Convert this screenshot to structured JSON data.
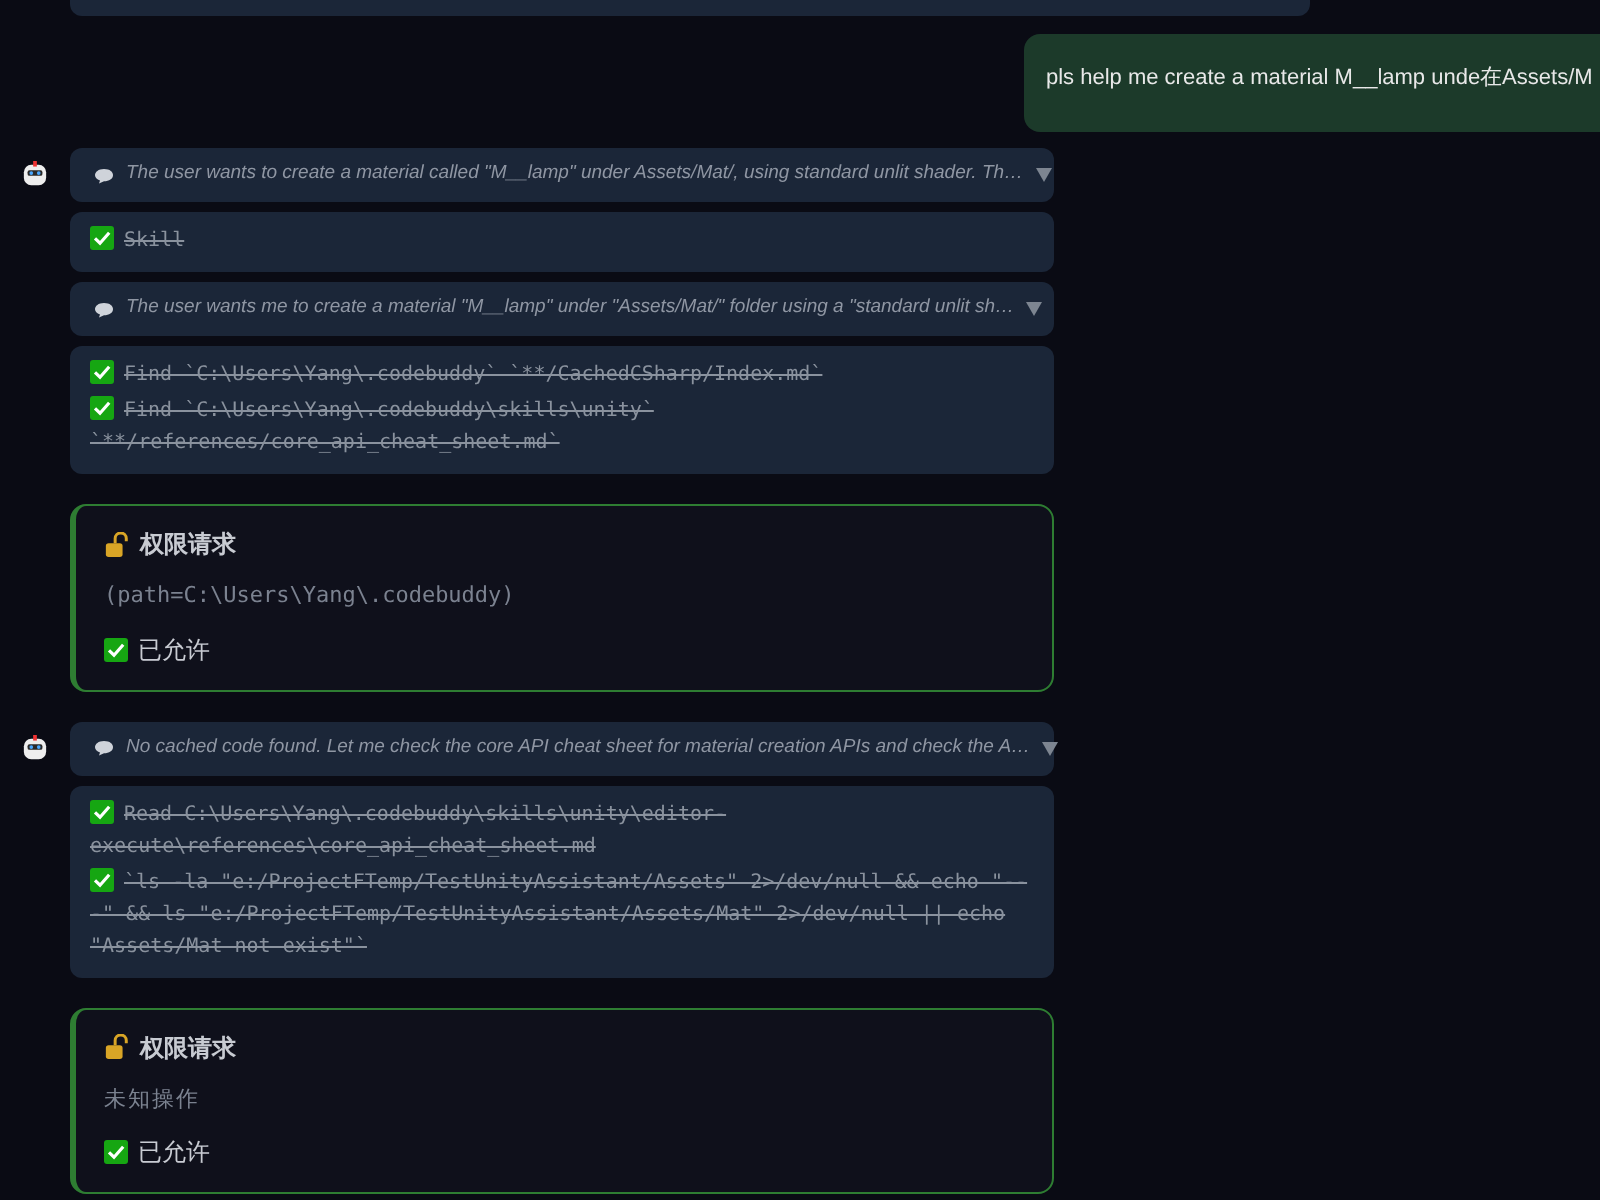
{
  "user_message": {
    "text": "pls help me create a material M__lamp unde在Assets/M"
  },
  "assistant_turns": [
    {
      "blocks": [
        {
          "kind": "thought",
          "text": "The user wants to create a material called \"M__lamp\" under Assets/Mat/, using standard unlit shader. Th…",
          "expanded": false
        },
        {
          "kind": "tools",
          "items": [
            {
              "text": "Skill",
              "done": true
            }
          ]
        },
        {
          "kind": "thought",
          "text": "The user wants me to create a material \"M__lamp\" under \"Assets/Mat/\" folder using a \"standard unlit sh…",
          "expanded": false
        },
        {
          "kind": "tools",
          "items": [
            {
              "text": "Find `C:\\Users\\Yang\\.codebuddy` `**/CachedCSharp/Index.md`",
              "done": true
            },
            {
              "text": "Find `C:\\Users\\Yang\\.codebuddy\\skills\\unity` `**/references/core_api_cheat_sheet.md`",
              "done": true
            }
          ]
        },
        {
          "kind": "permission",
          "title": "权限请求",
          "detail": "(path=C:\\Users\\Yang\\.codebuddy)",
          "detail_mono": true,
          "status": "已允许",
          "allowed": true
        }
      ]
    },
    {
      "blocks": [
        {
          "kind": "thought",
          "text": "No cached code found. Let me check the core API cheat sheet for material creation APIs and check the A…",
          "expanded": false
        },
        {
          "kind": "tools",
          "items": [
            {
              "text": "Read C:\\Users\\Yang\\.codebuddy\\skills\\unity\\editor-execute\\references\\core_api_cheat_sheet.md",
              "done": true
            },
            {
              "text": "`ls -la \"e:/ProjectFTemp/TestUnityAssistant/Assets\" 2>/dev/null && echo \"---\" && ls \"e:/ProjectFTemp/TestUnityAssistant/Assets/Mat\" 2>/dev/null || echo \"Assets/Mat not exist\"`",
              "done": true
            }
          ]
        },
        {
          "kind": "permission",
          "title": "权限请求",
          "detail": "未知操作",
          "detail_mono": false,
          "status": "已允许",
          "allowed": true
        }
      ]
    }
  ]
}
